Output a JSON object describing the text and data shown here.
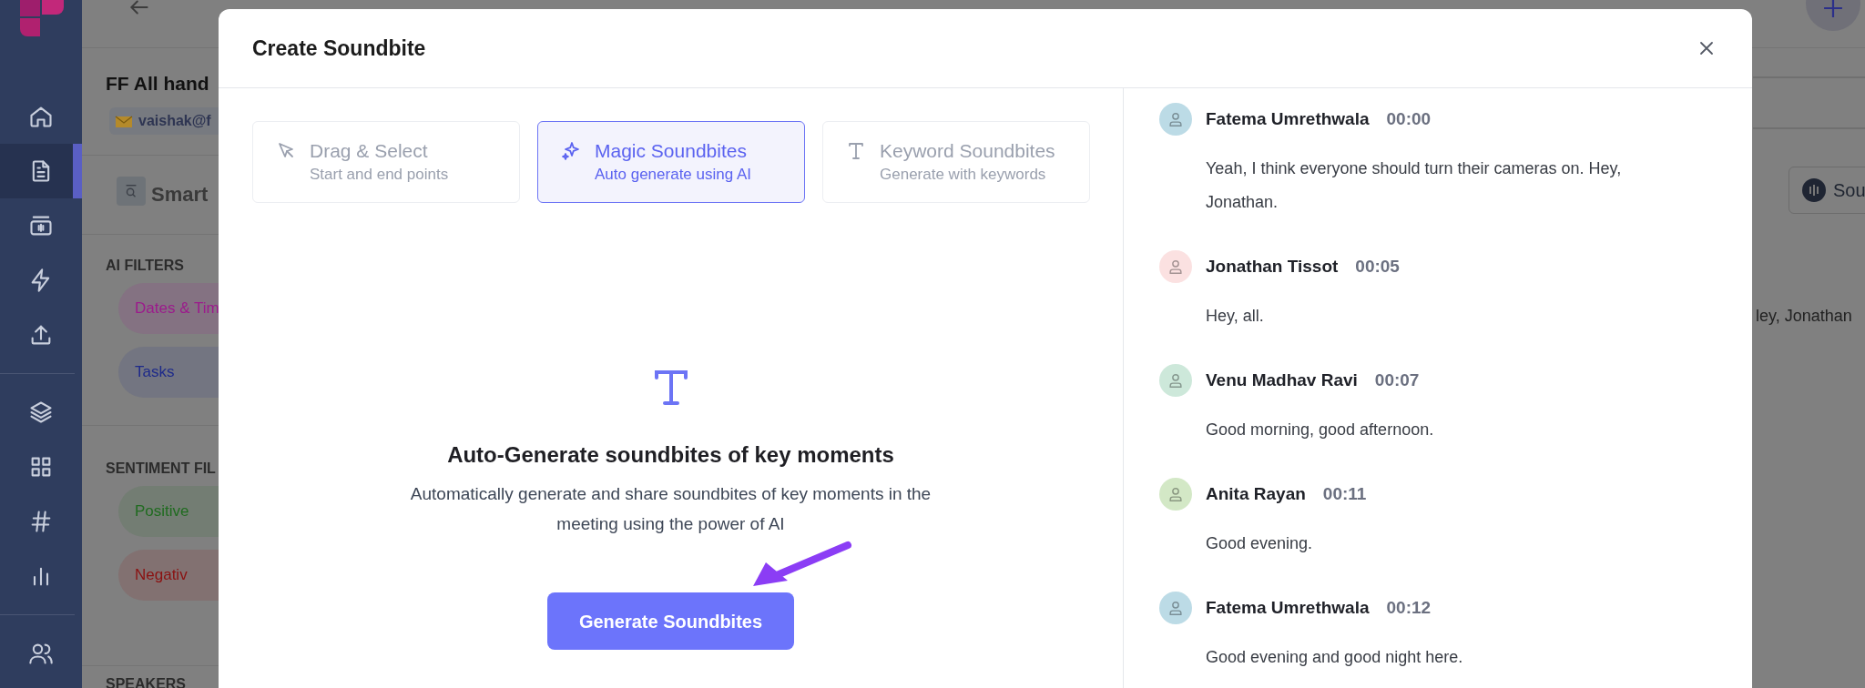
{
  "sidebar": {
    "items": [
      {
        "selected": false
      },
      {
        "selected": true
      },
      {
        "selected": false
      },
      {
        "selected": false
      },
      {
        "selected": false
      },
      {
        "selected": false
      },
      {
        "selected": false
      },
      {
        "selected": false
      },
      {
        "selected": false
      },
      {
        "selected": false
      }
    ]
  },
  "background": {
    "meeting_title": "FF All hand",
    "owner": "vaishak@f",
    "section_title": "Smart",
    "ai_filters": {
      "heading": "AI FILTERS",
      "chips": [
        {
          "label": "Dates & Tim",
          "color": "#9c1a8c"
        },
        {
          "label": "Tasks",
          "color": "#1e2a8a"
        }
      ]
    },
    "sentiment_filters": {
      "heading": "SENTIMENT FIL",
      "chips": [
        {
          "label": "Positive",
          "color": "#1f6b1f"
        },
        {
          "label": "Negativ",
          "color": "#8b1111"
        }
      ]
    },
    "speakers_heading": "SPEAKERS",
    "soundbite_button": "Sou",
    "transcript_fragment": "ley, Jonathan"
  },
  "dialog": {
    "title": "Create Soundbite",
    "tabs": [
      {
        "kind": "pointer",
        "label": "Drag & Select",
        "sublabel": "Start and end points",
        "selected": false
      },
      {
        "kind": "sparkle",
        "label": "Magic Soundbites",
        "sublabel": "Auto generate using AI",
        "selected": true
      },
      {
        "kind": "text",
        "label": "Keyword Soundbites",
        "sublabel": "Generate with keywords",
        "selected": false
      }
    ],
    "heading": "Auto-Generate soundbites of key moments",
    "description": "Automatically generate and share soundbites of key moments in the meeting using the power of AI",
    "button": "Generate Soundbites",
    "transcript": [
      {
        "speaker": "Fatema Umrethwala",
        "time": "00:00",
        "color": "#bcdbe6",
        "text": "Yeah, I think everyone should turn their cameras on. Hey, Jonathan."
      },
      {
        "speaker": "Jonathan Tissot",
        "time": "00:05",
        "color": "#fbe1e1",
        "text": "Hey, all."
      },
      {
        "speaker": "Venu Madhav Ravi",
        "time": "00:07",
        "color": "#cde8da",
        "text": "Good morning, good afternoon."
      },
      {
        "speaker": "Anita Rayan",
        "time": "00:11",
        "color": "#d3e8c6",
        "text": "Good evening."
      },
      {
        "speaker": "Fatema Umrethwala",
        "time": "00:12",
        "color": "#bcdbe6",
        "text": "Good evening and good night here."
      }
    ]
  }
}
